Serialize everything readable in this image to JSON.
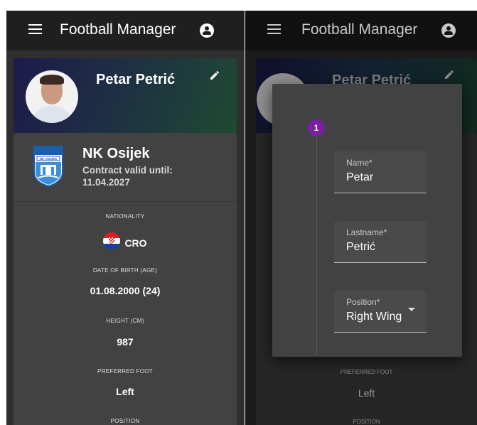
{
  "app": {
    "title": "Football Manager"
  },
  "player": {
    "name": "Petar Petrić",
    "club": "NK Osijek",
    "contract": "Contract valid until: 11.04.2027",
    "club_logo_text": "NK OSIJEK"
  },
  "fields": {
    "nationality_label": "NATIONALITY",
    "nationality_value": "CRO",
    "dob_label": "DATE OF BIRTH (AGE)",
    "dob_value": "01.08.2000 (24)",
    "height_label": "HEIGHT (CM)",
    "height_value": "987",
    "foot_label": "PREFERRED FOOT",
    "foot_value": "Left",
    "position_label": "POSITION"
  },
  "edit_dialog": {
    "step_number": "1",
    "name_label": "Name*",
    "name_value": "Petar",
    "lastname_label": "Lastname*",
    "lastname_value": "Petrić",
    "position_label": "Position*",
    "position_value": "Right Wing"
  },
  "colors": {
    "accent": "#7b1fa2",
    "appbar": "#1f1f1f",
    "card": "#424242"
  },
  "icons": [
    "menu-icon",
    "account-icon",
    "edit-icon",
    "flag-croatia-icon",
    "dropdown-caret-icon"
  ]
}
